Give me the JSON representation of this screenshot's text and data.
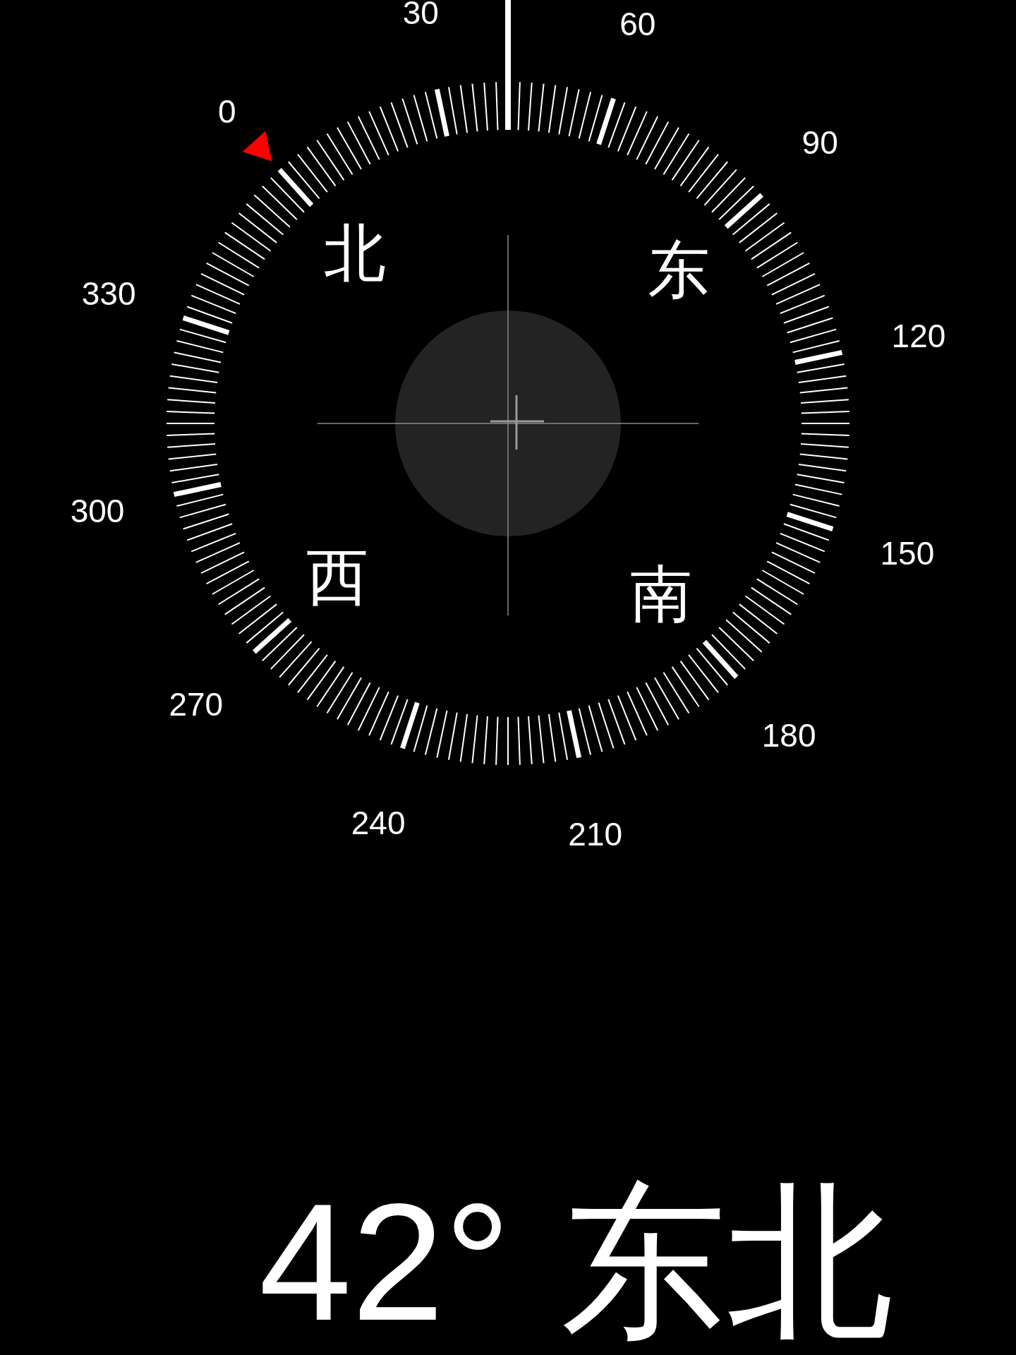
{
  "dial": {
    "degree_labels": [
      "0",
      "30",
      "60",
      "90",
      "120",
      "150",
      "180",
      "210",
      "240",
      "270",
      "300",
      "330"
    ],
    "cardinal_labels": [
      "北",
      "东",
      "西",
      "南"
    ]
  },
  "heading": {
    "degrees": "42°",
    "direction": "东北"
  }
}
